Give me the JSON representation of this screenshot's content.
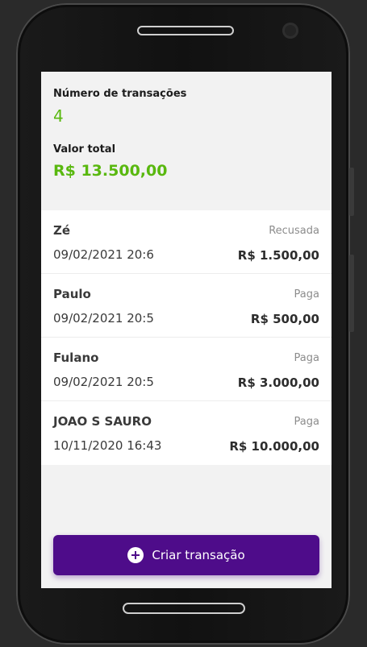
{
  "summary": {
    "count_label": "Número de transações",
    "count_value": "4",
    "total_label": "Valor total",
    "total_value": "R$ 13.500,00"
  },
  "transactions": [
    {
      "name": "Zé",
      "status": "Recusada",
      "date": "09/02/2021 20:6",
      "amount": "R$ 1.500,00"
    },
    {
      "name": "Paulo",
      "status": "Paga",
      "date": "09/02/2021 20:5",
      "amount": "R$ 500,00"
    },
    {
      "name": "Fulano",
      "status": "Paga",
      "date": "09/02/2021 20:5",
      "amount": "R$ 3.000,00"
    },
    {
      "name": "JOAO S SAURO",
      "status": "Paga",
      "date": "10/11/2020 16:43",
      "amount": "R$ 10.000,00"
    }
  ],
  "create_button": {
    "label": "Criar transação",
    "icon": "plus-circle-icon"
  },
  "colors": {
    "accent": "#4e0c8a",
    "positive": "#59b80f"
  }
}
